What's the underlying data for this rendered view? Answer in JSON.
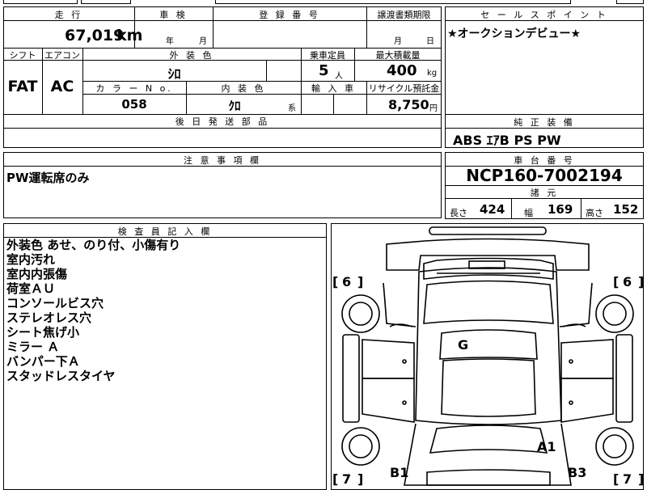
{
  "specs": {
    "headers": {
      "mileage": "走 行",
      "inspection": "車 検",
      "registration": "登 録 番 号",
      "transfer_deadline": "譲渡書類期限",
      "shift": "シフト",
      "aircon": "エアコン",
      "exterior_color": "外 装 色",
      "capacity": "乗車定員",
      "max_load": "最大積載量",
      "color_no": "カ ラ ー N o.",
      "interior_color": "内 装 色",
      "import": "輸 入 車",
      "recycle": "リサイクル預託金",
      "later_parts": "後 日 発 送 部 品"
    },
    "mileage": "67,019",
    "mileage_unit": "km",
    "inspection_year_unit": "年",
    "inspection_month_unit": "月",
    "deadline_month_unit": "月",
    "deadline_day_unit": "日",
    "shift": "FAT",
    "aircon": "AC",
    "exterior_color": "ｼﾛ",
    "capacity": "5",
    "capacity_unit": "人",
    "max_load": "400",
    "max_load_unit": "kg",
    "color_no": "058",
    "interior_color": "ｸﾛ",
    "interior_suffix": "系",
    "recycle": "8,750",
    "recycle_unit": "円"
  },
  "sales_point": {
    "title": "セ ー ル ス ポ イ ン ト",
    "text": "★オークションデビュー★"
  },
  "standard_equipment": {
    "title": "純 正 装 備",
    "text": "ABS ｴｱB PS PW"
  },
  "notes": {
    "title": "注 意 事 項 欄",
    "text": "PW運転席のみ"
  },
  "chassis": {
    "title": "車 台 番 号",
    "number": "NCP160-7002194"
  },
  "dimensions": {
    "title": "諸 元",
    "length_label": "長さ",
    "length": "424",
    "width_label": "幅",
    "width": "169",
    "height_label": "高さ",
    "height": "152"
  },
  "inspector": {
    "title": "検 査 員 記 入 欄",
    "lines": [
      "外装色 あせ、のり付、小傷有り",
      "室内汚れ",
      "室内内張傷",
      "荷室ＡＵ",
      "コンソールビス穴",
      "ステレオレス穴",
      "シート焦げ小",
      "ミラー Ａ",
      "バンパー下Ａ",
      "スタッドレスタイヤ"
    ]
  },
  "diagram": {
    "marks": {
      "g": "G",
      "a1": "A1",
      "b1": "B1",
      "b3": "B3",
      "tire_front_left": "6",
      "tire_front_right": "6",
      "tire_rear_left": "7",
      "tire_rear_right": "7"
    }
  }
}
